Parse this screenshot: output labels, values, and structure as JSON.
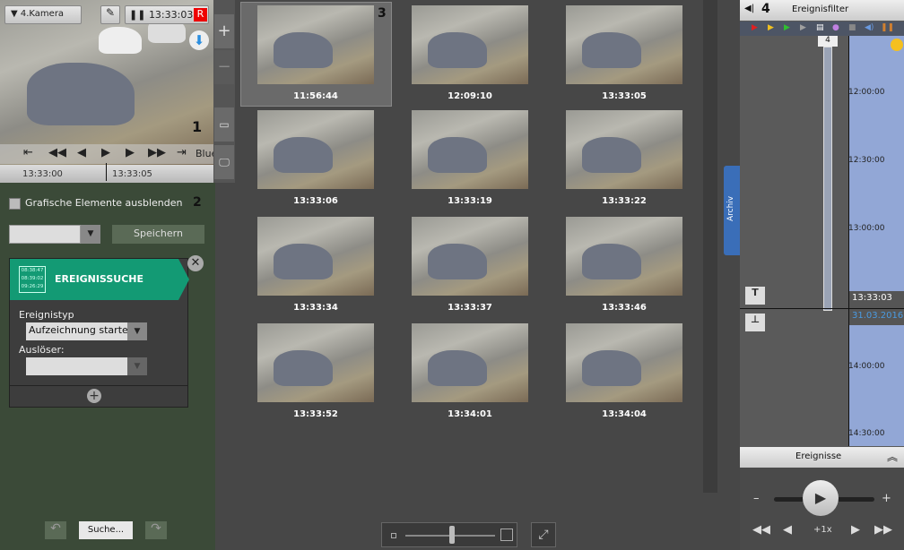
{
  "camera": {
    "name": "4.Kamera",
    "time": "13:33:03",
    "rec_badge": "R",
    "marker": "1",
    "overlay_text": "Blue",
    "timeline_ticks": [
      "13:33:00",
      "13:33:05"
    ]
  },
  "left_panel": {
    "hide_graphics_label": "Grafische Elemente ausblenden",
    "marker": "2",
    "preset_value": "",
    "save_label": "Speichern",
    "search_card": {
      "title": "EREIGNISSUCHE",
      "icon_times": [
        "08:38:47",
        "08:39:02",
        "09:26:29"
      ],
      "event_type_label": "Ereignistyp",
      "event_type_value": "Aufzeichnung starten",
      "trigger_label": "Auslöser:",
      "trigger_value": ""
    },
    "search_button": "Suche..."
  },
  "results": {
    "marker": "3",
    "thumbnails": [
      "11:56:44",
      "12:09:10",
      "13:33:05",
      "13:33:06",
      "13:33:19",
      "13:33:22",
      "13:33:34",
      "13:33:37",
      "13:33:46",
      "13:33:52",
      "13:34:01",
      "13:34:04"
    ]
  },
  "archive_tab": "Archiv",
  "right_panel": {
    "marker": "4",
    "title": "Ereignisfilter",
    "count": "4",
    "time_labels": [
      "12:00:00",
      "12:30:00",
      "13:00:00",
      "14:00:00",
      "14:30:00"
    ],
    "current_time": "13:33:03",
    "current_date": "31.03.2016",
    "filter_colors": [
      "#e02020",
      "#f0c020",
      "#30c030",
      "#a0a0a0"
    ],
    "events_title": "Ereignisse",
    "speed": "+1x",
    "minus": "–",
    "plus": "+"
  }
}
